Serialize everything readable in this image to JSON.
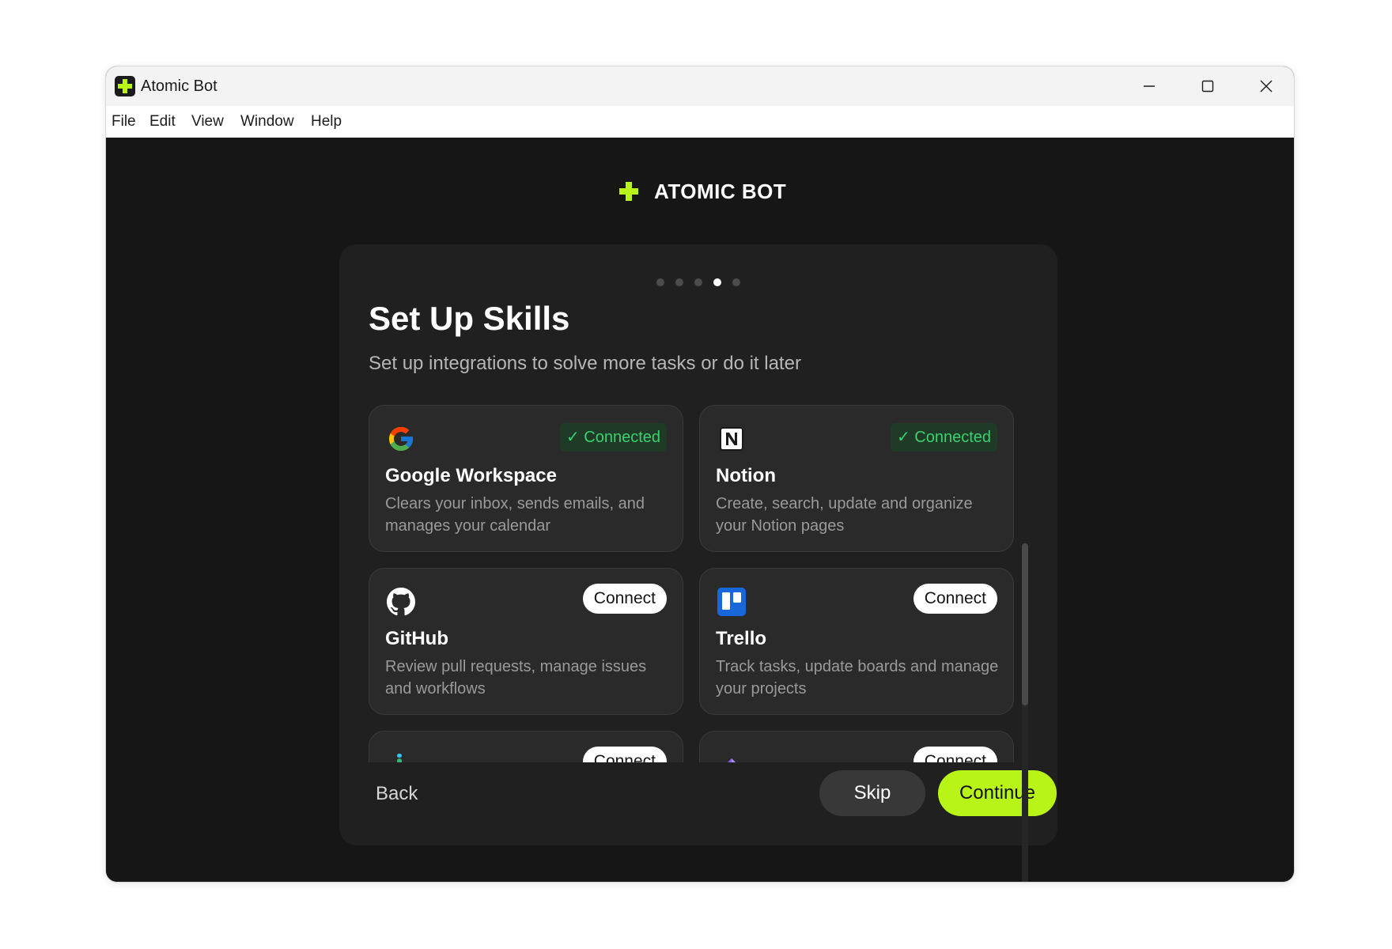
{
  "window": {
    "title": "Atomic Bot",
    "controls": [
      "minimize",
      "maximize",
      "close"
    ]
  },
  "menu": [
    "File",
    "Edit",
    "View",
    "Window",
    "Help"
  ],
  "brand": {
    "name": "ATOMIC BOT",
    "accent": "#b9f418"
  },
  "onboarding": {
    "steps_total": 5,
    "current_step": 4,
    "title": "Set Up Skills",
    "subtitle": "Set up integrations to solve more tasks or do it later"
  },
  "skills": [
    {
      "name": "Google Workspace",
      "description": "Clears your inbox, sends emails, and manages your calendar",
      "status": "✓ Connected",
      "icon": "google-icon"
    },
    {
      "name": "Notion",
      "description": "Create, search, update and organize your Notion pages",
      "status": "✓ Connected",
      "icon": "notion-icon"
    },
    {
      "name": "GitHub",
      "description": "Review pull requests, manage issues and workflows",
      "action": "Connect",
      "icon": "github-icon"
    },
    {
      "name": "Trello",
      "description": "Track tasks, update boards and manage your projects",
      "action": "Connect",
      "icon": "trello-icon"
    },
    {
      "name": "",
      "description": "",
      "action": "Connect",
      "icon": "slack-icon"
    },
    {
      "name": "",
      "description": "",
      "action": "Connect",
      "icon": "obsidian-icon"
    }
  ],
  "footer": {
    "back": "Back",
    "skip": "Skip",
    "continue": "Continue"
  }
}
